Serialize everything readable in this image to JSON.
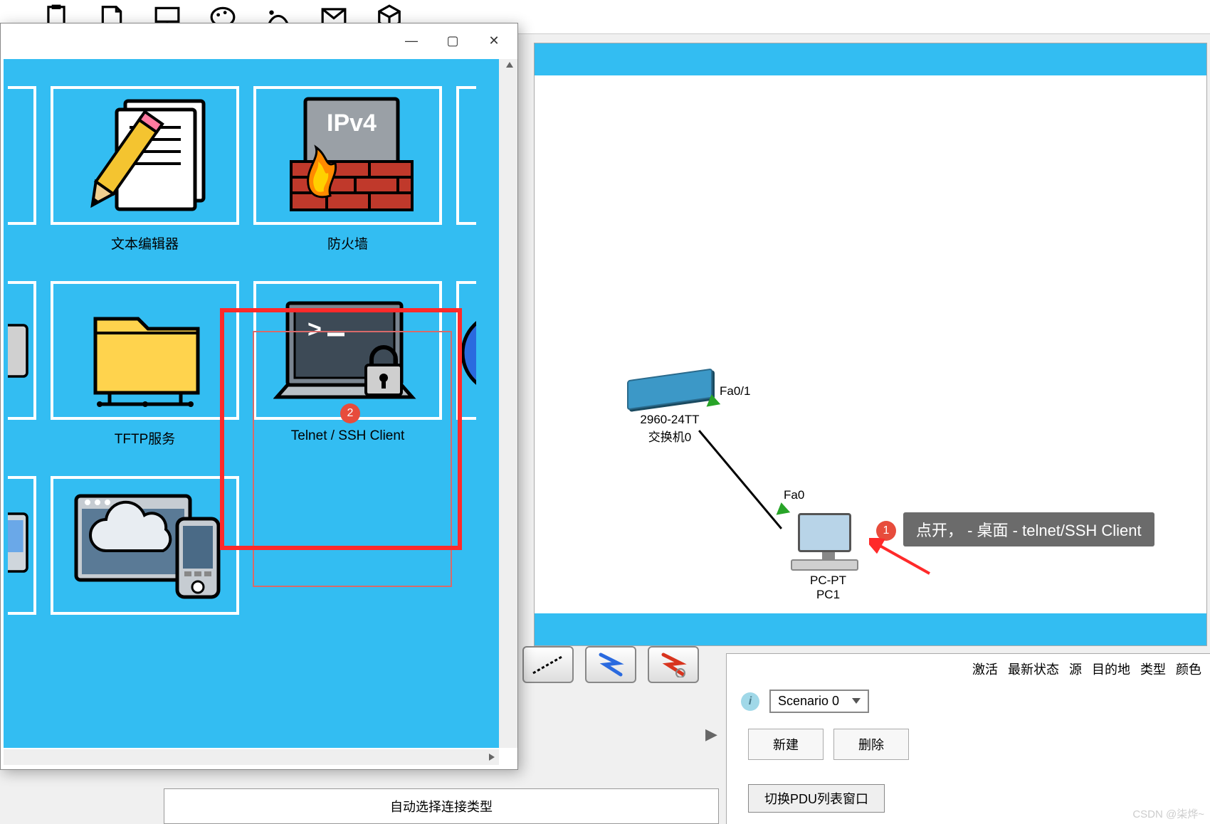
{
  "toolbar_icons": [
    "clipboard-icon",
    "note-icon",
    "desktop-icon",
    "palette-icon",
    "custom-shape-icon",
    "envelope-icon",
    "box-icon"
  ],
  "popup": {
    "row1": {
      "tile1_label": "文本编辑器",
      "tile2_label": "防火墙",
      "ipv4_text": "IPv4"
    },
    "row2": {
      "tile1_label": "TFTP服务",
      "tile2_label": "Telnet / SSH Client"
    },
    "annotation_badge_2": "2",
    "window_controls": {
      "min": "—",
      "max": "▢",
      "close": "✕"
    }
  },
  "topology": {
    "switch": {
      "model": "2960-24TT",
      "name": "交换机0"
    },
    "pc": {
      "model": "PC-PT",
      "name": "PC1"
    },
    "port_switch": "Fa0/1",
    "port_pc": "Fa0"
  },
  "annotations": {
    "badge_1": "1",
    "callout_text": "点开，  - 桌面   - telnet/SSH Client"
  },
  "simulation": {
    "columns": [
      "激活",
      "最新状态",
      "源",
      "目的地",
      "类型",
      "颜色"
    ],
    "scenario_label": "Scenario 0",
    "new_button": "新建",
    "delete_button": "删除",
    "pdu_toggle": "切换PDU列表窗口",
    "info_icon": "i"
  },
  "footer_text": "自动选择连接类型",
  "watermark": "CSDN @柒烨~"
}
